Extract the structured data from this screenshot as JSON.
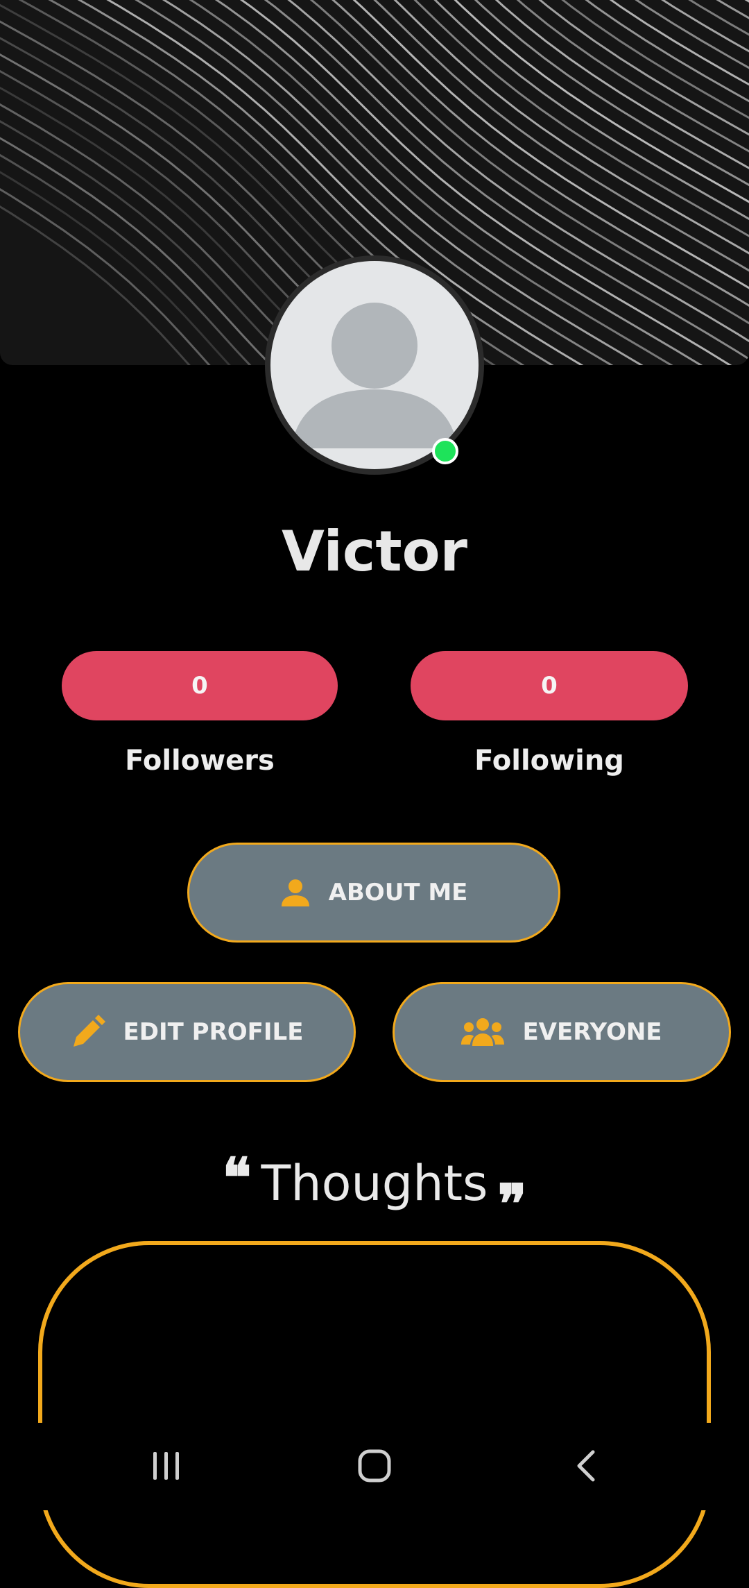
{
  "profile": {
    "name": "Victor",
    "online": true
  },
  "stats": {
    "followers_count": "0",
    "followers_label": "Followers",
    "following_count": "0",
    "following_label": "Following"
  },
  "actions": {
    "about_me": "ABOUT ME",
    "edit_profile": "EDIT PROFILE",
    "everyone": "EVERYONE"
  },
  "thoughts": {
    "title": "Thoughts",
    "open_quote": "❝",
    "close_quote": "❞"
  },
  "icons": {
    "about_me": "person-icon",
    "edit_profile": "pencil-icon",
    "everyone": "group-icon",
    "nav_recents": "recents-icon",
    "nav_home": "home-icon",
    "nav_back": "back-icon"
  },
  "colors": {
    "background": "#000000",
    "accent": "#f2a91c",
    "stat_pill": "#e04560",
    "button": "#6b7a82",
    "online": "#1ee35a"
  }
}
